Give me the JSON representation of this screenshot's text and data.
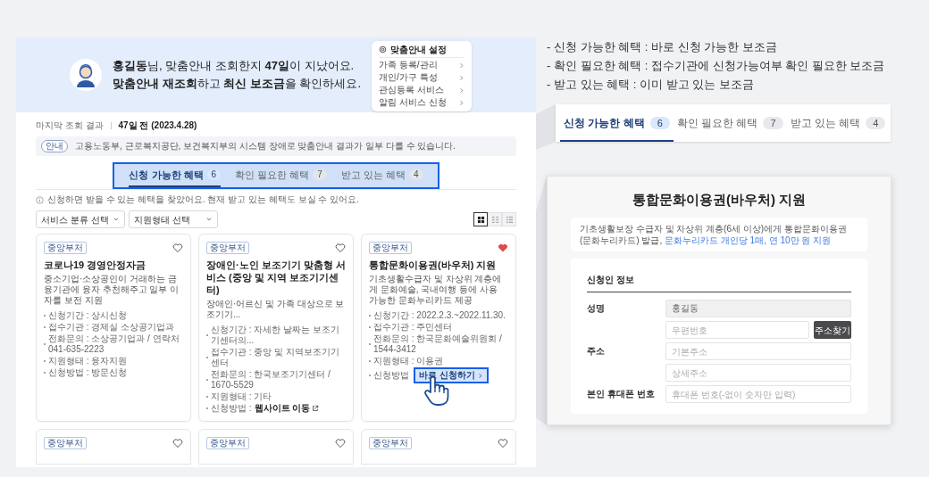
{
  "legend": [
    "- 신청 가능한 혜택 : 바로 신청 가능한 보조금",
    "- 확인 필요한 혜택 : 접수기관에 신청가능여부 확인 필요한 보조금",
    "- 받고 있는 혜택 : 이미 받고 있는 보조금"
  ],
  "banner": {
    "greeting": "**홍길동**님, 맞춤안내 조회한지 **47일**이 지났어요.",
    "prompt": "**맞춤안내 재조회**하고 **최신 보조금**을 확인하세요.",
    "settings": {
      "title": "맞춤안내 설정",
      "items": [
        "가족 등록/관리",
        "개인/가구 특성",
        "관심등록 서비스",
        "알림 서비스 신청"
      ]
    }
  },
  "last_result": {
    "label": "마지막 조회 결과",
    "value": "47일 전 (2023.4.28)"
  },
  "notice": {
    "badge": "안내",
    "text": "고용노동부, 근로복지공단, 보건복지부의 시스템 장애로 맞춤안내 결과가 일부 다를 수 있습니다."
  },
  "result_tabs": [
    {
      "label": "신청 가능한 혜택",
      "count": "6",
      "selected": true
    },
    {
      "label": "확인 필요한 혜택",
      "count": "7",
      "selected": false
    },
    {
      "label": "받고 있는 혜택",
      "count": "4",
      "selected": false
    }
  ],
  "info": "신청하면 받을 수 있는 혜택을 찾았어요. 현재 받고 있는 혜택도 보실 수 있어요.",
  "filters": [
    "서비스 분류 선택",
    "지원형태 선택"
  ],
  "view_modes": [
    {
      "kind": "grid",
      "selected": true
    },
    {
      "kind": "list",
      "selected": false
    },
    {
      "kind": "table",
      "selected": false
    }
  ],
  "cards": [
    {
      "badge": "중앙부처",
      "title": "코로나19 경영안정자금",
      "description": "중소기업·소상공인이 거래하는 금융기관에 융자 추천해주고 일부 이자를 보전 지원",
      "favorite": false,
      "details": [
        "신청기간 : 상시신청",
        "접수기관 : 경제실 소상공기업과",
        "전화문의 : 소상공기업과 / 연락처 041-635-2223",
        "지원형태 : 융자지원",
        "신청방법 : 방문신청"
      ]
    },
    {
      "badge": "중앙부처",
      "title": "장애인·노인 보조기기 맞춤형 서비스 (중앙 및 지역 보조기기센터)",
      "description": "장애인·어르신 및 가족 대상으로 보조기기...",
      "favorite": false,
      "details": [
        "신청기간 : 자세한 날짜는 보조기기센터의...",
        "접수기관 : 중앙 및 지역보조기기센터",
        "전화문의 : 한국보조기기센터 / 1670-5529",
        "지원형태 : 기타",
        "신청방법 :"
      ],
      "link": "웹사이트 이동"
    },
    {
      "badge": "중앙부처",
      "title": "통합문화이용권(바우처) 지원",
      "description": "기초생활수급자 및 차상위 계층에게 문화예술, 국내여행 등에 사용 가능한 문화누리카드 제공",
      "favorite": true,
      "details": [
        "신청기간 : 2022.2.3.~2022.11.30.",
        "접수기관 : 주민센터",
        "전화문의 : 한국문화예술위원회 / 1544-3412",
        "지원형태 : 이용권",
        "신청방법"
      ],
      "action": "바로 신청하기"
    }
  ],
  "more_cards": [
    {
      "badge": "중앙부처",
      "favorite": false
    },
    {
      "badge": "중앙부처",
      "favorite": false
    },
    {
      "badge": "중앙부처",
      "favorite": false
    }
  ],
  "zoom_tabs": [
    {
      "label": "신청 가능한 혜택",
      "count": "6",
      "selected": true
    },
    {
      "label": "확인 필요한 혜택",
      "count": "7",
      "selected": false
    },
    {
      "label": "받고 있는 혜택",
      "count": "4",
      "selected": false
    }
  ],
  "form": {
    "title": "통합문화이용권(바우처) 지원",
    "summary": "기초생활보장 수급자 및 차상위 계층(6세 이상)에게 통합문화이용권(문화누리카드) 발급,",
    "summary_highlight": "문화누리카드 개인당 1매, 연 10만 원 지원",
    "section": "신청인 정보",
    "fields": [
      {
        "kind": "readonly",
        "label": "성명",
        "value": "홍길동"
      },
      {
        "kind": "address",
        "label": "주소",
        "inputs": [
          {
            "placeholder": "우편번호",
            "button": "주소찾기"
          },
          {
            "placeholder": "기본주소"
          },
          {
            "placeholder": "상세주소"
          }
        ]
      },
      {
        "kind": "text",
        "label": "본인 휴대폰 번호",
        "placeholder": "휴대폰 번호(-없이 숫자만 입력)"
      }
    ]
  }
}
